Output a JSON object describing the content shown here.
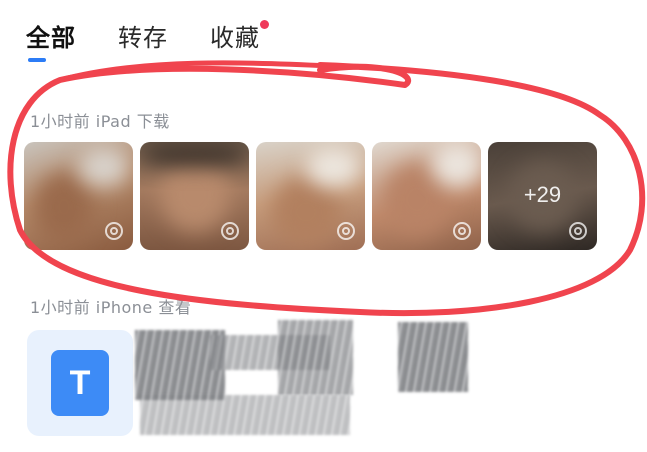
{
  "tabs": [
    {
      "label": "全部"
    },
    {
      "label": "转存"
    },
    {
      "label": "收藏"
    }
  ],
  "groups": [
    {
      "label": "1小时前 iPad 下载",
      "more_count": "+29"
    },
    {
      "label": "1小时前 iPhone 查看",
      "file_icon_letter": "T"
    }
  ],
  "colors": {
    "accent": "#2c7cf6",
    "badge": "#ef3a5a",
    "annotation": "#f0444e"
  }
}
